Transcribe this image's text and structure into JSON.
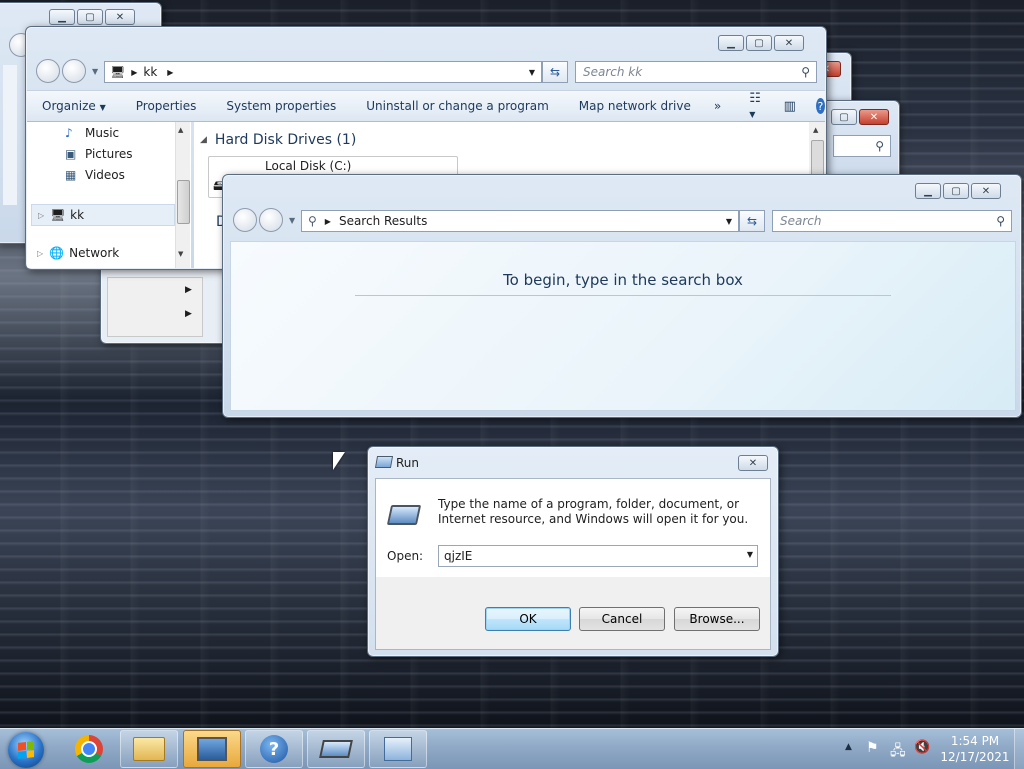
{
  "explorer": {
    "address_crumb": "kk",
    "search_placeholder": "Search kk",
    "toolbar": {
      "organize": "Organize",
      "properties": "Properties",
      "system_properties": "System properties",
      "uninstall": "Uninstall or change a program",
      "map_drive": "Map network drive",
      "more": "»"
    },
    "nav_items": [
      "Music",
      "Pictures",
      "Videos",
      "kk",
      "Network"
    ],
    "section_header": "Hard Disk Drives (1)",
    "drive_name": "Local Disk (C:)",
    "second_section_initial": "D"
  },
  "search_window": {
    "address_crumb": "Search Results",
    "search_placeholder": "Search",
    "message": "To begin, type in the search box"
  },
  "run_dialog": {
    "title": "Run",
    "description": "Type the name of a program, folder, document, or Internet resource, and Windows will open it for you.",
    "open_label": "Open:",
    "open_value": "qjzIE",
    "ok": "OK",
    "cancel": "Cancel",
    "browse": "Browse..."
  },
  "taskbar": {
    "time": "1:54 PM",
    "date": "12/17/2021"
  },
  "colors": {
    "accent": "#1e395b",
    "title_blue": "#1e5aa8",
    "taskbar": "#8fa9c6"
  }
}
